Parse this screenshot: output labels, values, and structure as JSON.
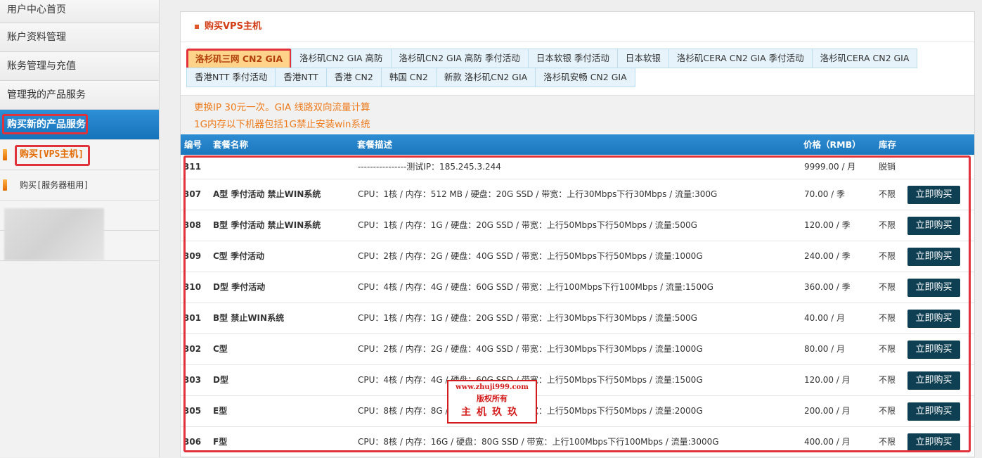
{
  "sidebar": {
    "items": [
      "用户中心首页",
      "账户资料管理",
      "账务管理与充值",
      "管理我的产品服务",
      "购买新的产品服务"
    ],
    "sub_items": [
      "购买[VPS主机]",
      "购买[服务器租用]"
    ]
  },
  "panel": {
    "title": "购买VPS主机",
    "tabs_row1": [
      "洛杉矶三网 CN2 GIA",
      "洛杉矶CN2 GIA 高防",
      "洛杉矶CN2 GIA 高防 季付活动",
      "日本软银 季付活动",
      "日本软银",
      "洛杉矶CERA CN2 GIA 季付活动",
      "洛杉矶CERA CN2 GIA"
    ],
    "tabs_row2": [
      "香港NTT 季付活动",
      "香港NTT",
      "香港 CN2",
      "韩国 CN2",
      "新款 洛杉矶CN2 GIA",
      "洛杉矶安畅 CN2 GIA"
    ],
    "notice": [
      "更换IP 30元一次。GIA 线路双向流量计算",
      "1G内存以下机器包括1G禁止安装win系统"
    ]
  },
  "table": {
    "headers": {
      "id": "编号",
      "name": "套餐名称",
      "desc": "套餐描述",
      "price": "价格（RMB）",
      "stock": "库存"
    },
    "buy_label": "立即购买",
    "rows": [
      {
        "id": "311",
        "name": "",
        "desc": "----------------测试IP：185.245.3.244",
        "price": "9999.00 / 月",
        "stock": "脱销",
        "buy": false
      },
      {
        "id": "307",
        "name": "A型 季付活动 禁止WIN系统",
        "desc": "CPU：1核 / 内存：512 MB / 硬盘：20G SSD / 带宽：上行30Mbps下行30Mbps / 流量:300G",
        "price": "70.00 / 季",
        "stock": "不限",
        "buy": true
      },
      {
        "id": "308",
        "name": "B型 季付活动 禁止WIN系统",
        "desc": "CPU：1核 / 内存：1G / 硬盘：20G SSD / 带宽：上行50Mbps下行50Mbps / 流量:500G",
        "price": "120.00 / 季",
        "stock": "不限",
        "buy": true
      },
      {
        "id": "309",
        "name": "C型 季付活动",
        "desc": "CPU：2核 / 内存：2G / 硬盘：40G SSD / 带宽：上行50Mbps下行50Mbps / 流量:1000G",
        "price": "240.00 / 季",
        "stock": "不限",
        "buy": true
      },
      {
        "id": "310",
        "name": "D型 季付活动",
        "desc": "CPU：4核 / 内存：4G / 硬盘：60G SSD / 带宽：上行100Mbps下行100Mbps / 流量:1500G",
        "price": "360.00 / 季",
        "stock": "不限",
        "buy": true
      },
      {
        "id": "301",
        "name": "B型 禁止WIN系统",
        "desc": "CPU：1核 / 内存：1G / 硬盘：20G SSD / 带宽：上行30Mbps下行30Mbps / 流量:500G",
        "price": "40.00 / 月",
        "stock": "不限",
        "buy": true
      },
      {
        "id": "302",
        "name": "C型",
        "desc": "CPU：2核 / 内存：2G / 硬盘：40G SSD / 带宽：上行30Mbps下行30Mbps / 流量:1000G",
        "price": "80.00 / 月",
        "stock": "不限",
        "buy": true
      },
      {
        "id": "303",
        "name": "D型",
        "desc": "CPU：4核 / 内存：4G / 硬盘：60G SSD / 带宽：上行50Mbps下行50Mbps / 流量:1500G",
        "price": "120.00 / 月",
        "stock": "不限",
        "buy": true
      },
      {
        "id": "305",
        "name": "E型",
        "desc": "CPU：8核 / 内存：8G / 硬盘：80G SSD / 带宽：上行50Mbps下行50Mbps / 流量:2000G",
        "price": "200.00 / 月",
        "stock": "不限",
        "buy": true
      },
      {
        "id": "306",
        "name": "F型",
        "desc": "CPU：8核 / 内存：16G / 硬盘：80G SSD / 带宽：上行100Mbps下行100Mbps / 流量:3000G",
        "price": "400.00 / 月",
        "stock": "不限",
        "buy": true
      }
    ]
  },
  "watermark": {
    "url": "www.zhuji999.com",
    "rights": "版权所有",
    "brand": "主机玖玖"
  }
}
